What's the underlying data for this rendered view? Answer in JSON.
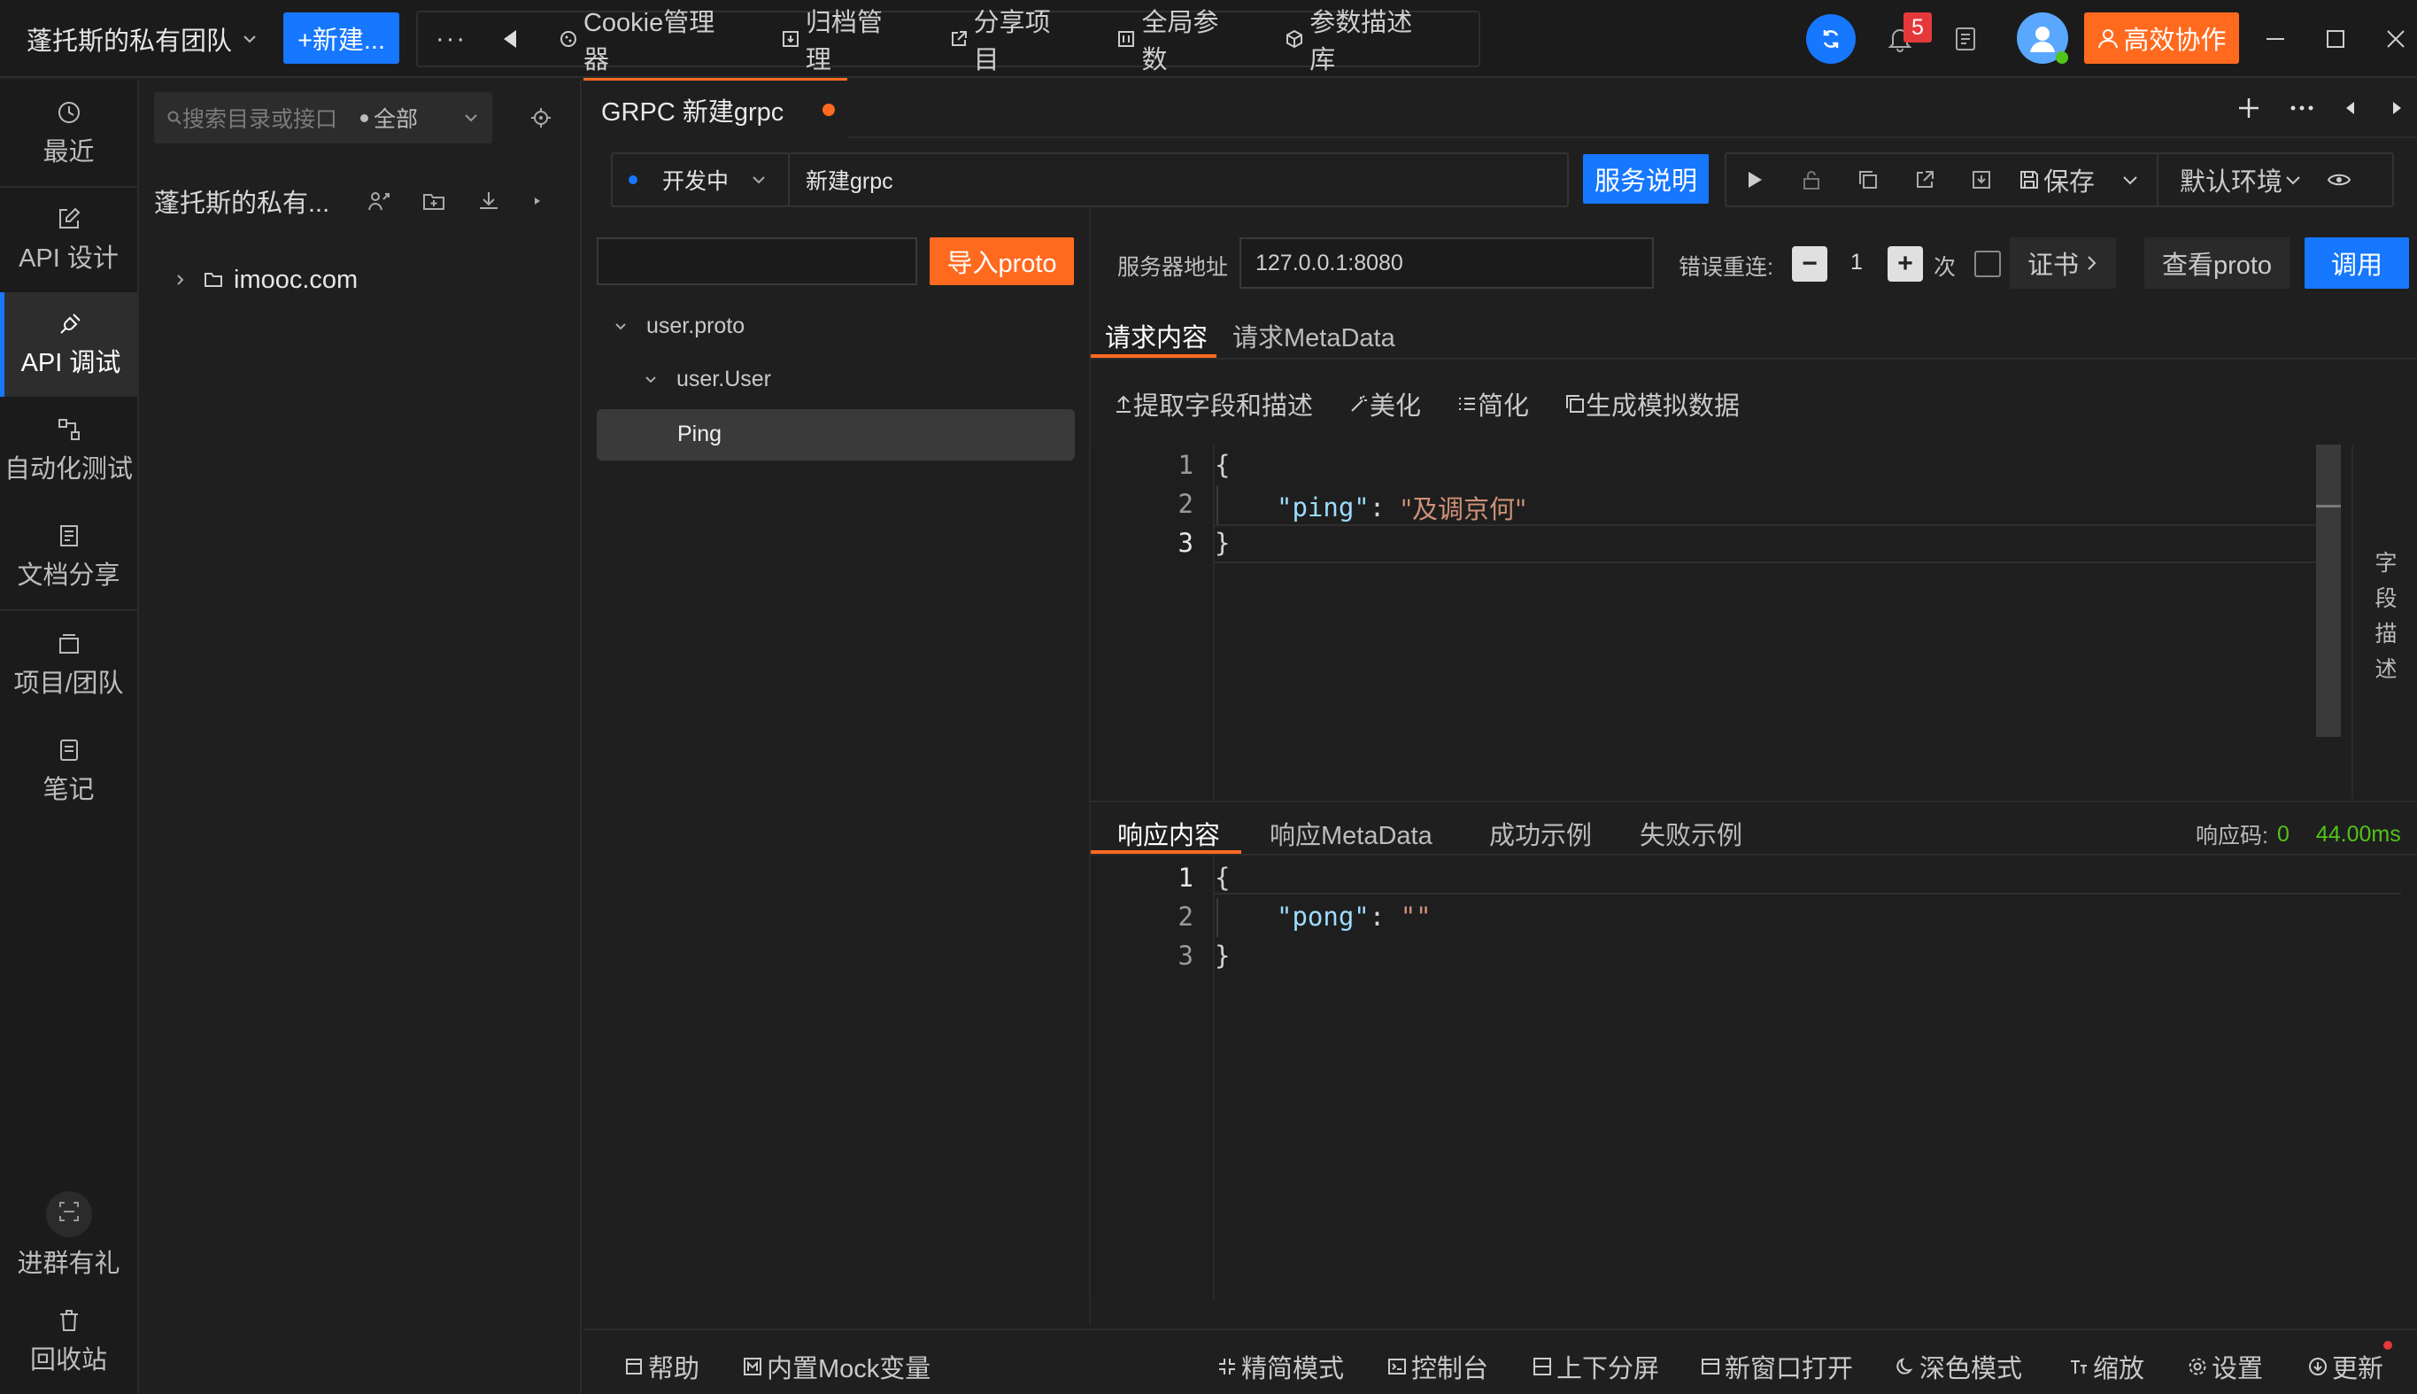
{
  "topbar": {
    "team_name": "蓬托斯的私有团队",
    "new_button": "+新建...",
    "more": "···",
    "tools": [
      "Cookie管理器",
      "归档管理",
      "分享项目",
      "全局参数",
      "参数描述库"
    ],
    "notification_count": "5",
    "collab_button": "高效协作"
  },
  "leftnav": {
    "items": [
      "最近",
      "API 设计",
      "API 调试",
      "自动化测试",
      "文档分享",
      "项目/团队",
      "笔记"
    ],
    "bottom": [
      "进群有礼",
      "回收站"
    ]
  },
  "tree": {
    "search_placeholder": "搜索目录或接口",
    "filter": "全部",
    "team_short": "蓬托斯的私有...",
    "folder": "imooc.com"
  },
  "tab": {
    "title": "GRPC 新建grpc"
  },
  "env": {
    "status": "开发中",
    "name": "新建grpc",
    "service_doc": "服务说明",
    "save": "保存",
    "environment": "默认环境"
  },
  "proto": {
    "import_button": "导入proto",
    "tree": [
      "user.proto",
      "user.User",
      "Ping"
    ]
  },
  "request": {
    "server_label": "服务器地址",
    "server_value": "127.0.0.1:8080",
    "retry_label": "错误重连:",
    "retry_count": "1",
    "retry_unit": "次",
    "cert": "证书",
    "view_proto": "查看proto",
    "invoke": "调用",
    "tabs": [
      "请求内容",
      "请求MetaData"
    ],
    "tools": [
      "提取字段和描述",
      "美化",
      "简化",
      "生成模拟数据"
    ],
    "code_lines": [
      {
        "n": "1",
        "text": "{"
      },
      {
        "n": "2",
        "key": "\"ping\"",
        "colon": ": ",
        "value": "\"及调京何\""
      },
      {
        "n": "3",
        "text": "}"
      }
    ],
    "side_label": [
      "字",
      "段",
      "描",
      "述"
    ]
  },
  "response": {
    "tabs": [
      "响应内容",
      "响应MetaData",
      "成功示例",
      "失败示例"
    ],
    "code_label": "响应码:",
    "code_value": "0",
    "time": "44.00ms",
    "code_lines": [
      {
        "n": "1",
        "text": "{"
      },
      {
        "n": "2",
        "key": "\"pong\"",
        "colon": ": ",
        "value": "\"\""
      },
      {
        "n": "3",
        "text": "}"
      }
    ]
  },
  "statusbar": {
    "left": [
      "帮助",
      "内置Mock变量"
    ],
    "right": [
      "精简模式",
      "控制台",
      "上下分屏",
      "新窗口打开",
      "深色模式",
      "缩放",
      "设置",
      "更新"
    ]
  },
  "colors": {
    "accent_blue": "#1677ff",
    "accent_orange": "#ff6a1f",
    "json_key": "#9cdcfe",
    "json_string": "#ce9178",
    "success_green": "#52c41a"
  }
}
